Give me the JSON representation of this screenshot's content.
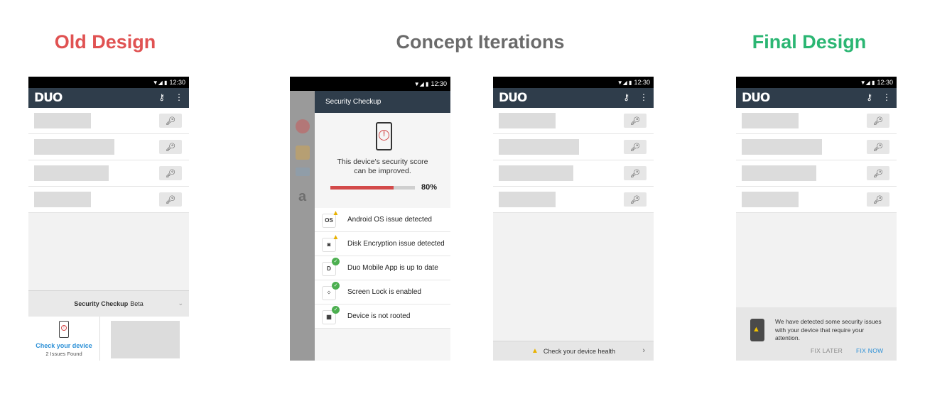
{
  "headings": {
    "old": "Old Design",
    "concepts": "Concept Iterations",
    "final": "Final Design"
  },
  "colors": {
    "old_heading": "#e05252",
    "concept_heading": "#6b6b6b",
    "final_heading": "#2bb673",
    "app_bar": "#2f3d4b",
    "score_fill": "#d34a4a",
    "link": "#2a8fd6"
  },
  "status_bar": {
    "time": "12:30"
  },
  "app_bar": {
    "logo": "DUO",
    "icons": [
      "add-key-icon",
      "overflow-menu-icon"
    ]
  },
  "old_design": {
    "sheet_title": "Security Checkup",
    "sheet_title_suffix": "Beta",
    "card_link": "Check your device",
    "card_sub": "2 Issues Found"
  },
  "concept_1": {
    "title": "Security Checkup",
    "score_text_1": "This device's security score",
    "score_text_2": "can be improved.",
    "score_value": "80%",
    "score_fraction": 0.75,
    "checks": [
      {
        "icon": "OS",
        "label": "Android OS issue detected",
        "status": "warning"
      },
      {
        "icon": "disk",
        "label": "Disk Encryption issue detected",
        "status": "warning"
      },
      {
        "icon": "duo",
        "label": "Duo Mobile App is up to date",
        "status": "ok"
      },
      {
        "icon": "lock",
        "label": "Screen Lock is enabled",
        "status": "ok"
      },
      {
        "icon": "root",
        "label": "Device is not rooted",
        "status": "ok"
      }
    ],
    "side_glyph": "a"
  },
  "concept_2": {
    "health_label": "Check your device health"
  },
  "final_design": {
    "notice_text": "We have detected some security issues with your device that require your attention.",
    "fix_later": "FIX LATER",
    "fix_now": "FIX NOW"
  }
}
